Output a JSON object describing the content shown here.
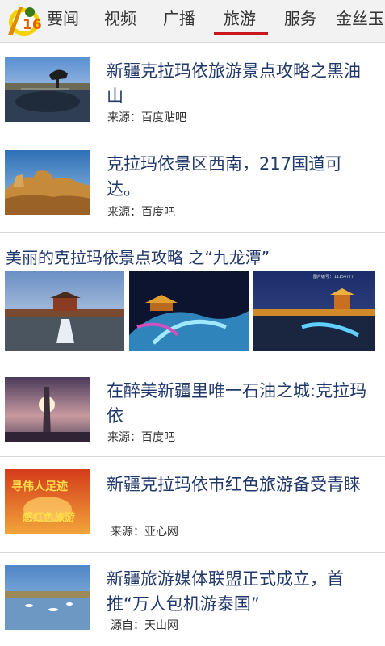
{
  "nav": {
    "tabs": [
      "要闻",
      "视频",
      "广播",
      "旅游",
      "服务",
      "金丝玉"
    ],
    "active_tab": "旅游"
  },
  "articles": [
    {
      "title": "新疆克拉玛依旅游景点攻略之黑油山",
      "source": "来源：百度贴吧",
      "image": "oil-mountain-statue-photo"
    },
    {
      "title": "克拉玛依景区西南，217国道可达。",
      "source": "来源：百度吧",
      "image": "yardang-landform-photo"
    }
  ],
  "gallery": {
    "title": "美丽的克拉玛依景点攻略 之“九龙潭”",
    "images": [
      "jiulongtan-gate-fountain-photo",
      "jiulongtan-night-fountain-photo",
      "jiulongtan-night-bridge-photo"
    ],
    "watermark": "图片编号: 11154777"
  },
  "articles2": [
    {
      "title": "在醉美新疆里唯一石油之城:克拉玛依",
      "source": "来源：百度吧",
      "image": "sunset-monument-photo"
    },
    {
      "title": "新疆克拉玛依市红色旅游备受青睐",
      "source": "来源：亚心网",
      "image": "red-tourism-poster-photo",
      "poster_line1": "寻伟人足迹",
      "poster_line2": "感红色旅游"
    },
    {
      "title": "新疆旅游媒体联盟正式成立，首推“万人包机游泰国”",
      "source": "源自：天山网",
      "image": "lake-swans-photo"
    }
  ],
  "colors": {
    "active_underline": "#c8171e",
    "title_text": "#21386b",
    "nav_bg": "#f2f2f2"
  }
}
